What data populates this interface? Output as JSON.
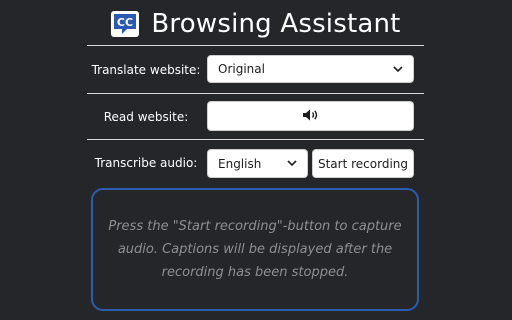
{
  "header": {
    "logo_icon": "cc-caption-icon",
    "title": "Browsing Assistant"
  },
  "translate": {
    "label": "Translate website:",
    "selected_option": "Original"
  },
  "read": {
    "label": "Read website:",
    "button_icon": "speaker-icon"
  },
  "transcribe": {
    "label": "Transcribe audio:",
    "language_selected": "English",
    "start_button_label": "Start recording"
  },
  "captions": {
    "placeholder_text": "Press the \"Start recording\"-button to capture audio. Captions will be displayed after the recording has been stopped."
  },
  "colors": {
    "background": "#24262a",
    "caption_border": "#2b5dae",
    "placeholder_text": "#8d8f94"
  }
}
